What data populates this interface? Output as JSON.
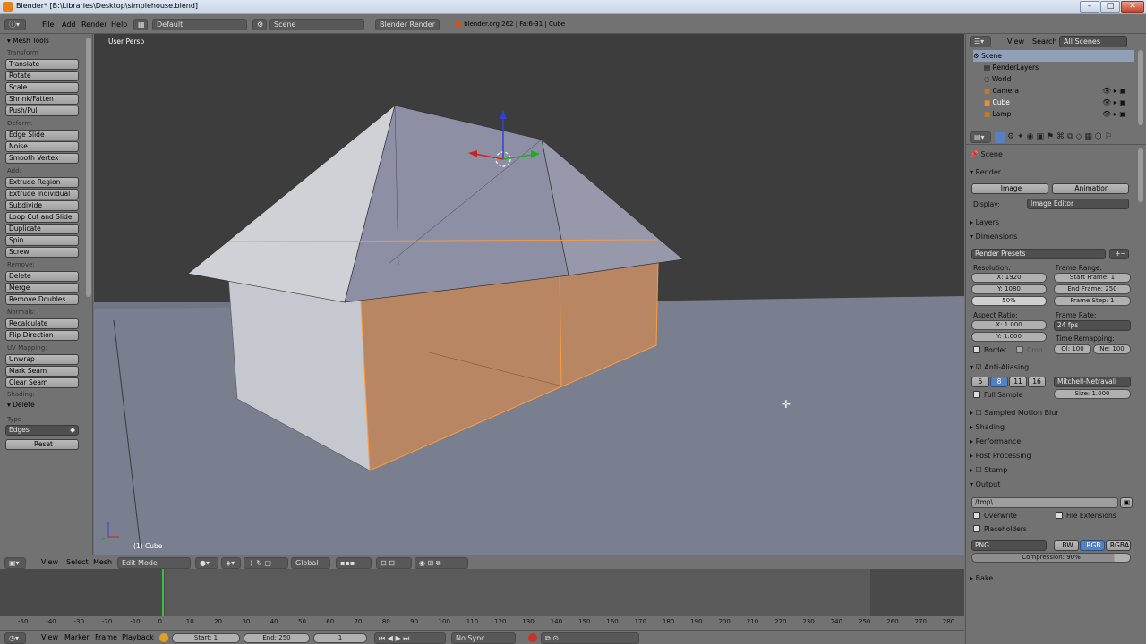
{
  "window": {
    "title": "Blender* [B:\\Libraries\\Desktop\\simplehouse.blend]",
    "min": "–",
    "max": "□",
    "close": "✕"
  },
  "info": {
    "menus": [
      "File",
      "Add",
      "Render",
      "Help"
    ],
    "screen": "Default",
    "scene": "Scene",
    "engine": "Blender Render",
    "stats": "blender.org 262 | Fa:6-31 | Cube"
  },
  "toolshelf": {
    "title": "Mesh Tools",
    "sections": [
      {
        "name": "Transform",
        "items": [
          "Translate",
          "Rotate",
          "Scale",
          "Shrink/Fatten",
          "Push/Pull"
        ]
      },
      {
        "name": "Deform:",
        "items": [
          "Edge Slide",
          "Noise",
          "Smooth Vertex"
        ]
      },
      {
        "name": "Add:",
        "items": [
          "Extrude Region",
          "Extrude Individual",
          "Subdivide",
          "Loop Cut and Slide",
          "Duplicate",
          "Spin",
          "Screw"
        ]
      },
      {
        "name": "Remove:",
        "items": [
          "Delete",
          "Merge",
          "Remove Doubles"
        ]
      },
      {
        "name": "Normals:",
        "items": [
          "Recalculate",
          "Flip Direction"
        ]
      },
      {
        "name": "UV Mapping:",
        "items": [
          "Unwrap",
          "Mark Seam",
          "Clear Seam"
        ]
      }
    ],
    "shading": "Shading:",
    "op_title": "Delete",
    "type_label": "Type",
    "type_value": "Edges",
    "reset": "Reset"
  },
  "viewport": {
    "mode_label": "User Persp",
    "object_label": "(1) Cube"
  },
  "vheader": {
    "menus": [
      "View",
      "Select",
      "Mesh"
    ],
    "mode": "Edit Mode",
    "orientation": "Global"
  },
  "timeline": {
    "ticks": [
      "-50",
      "-40",
      "-30",
      "-20",
      "-10",
      "0",
      "10",
      "20",
      "30",
      "40",
      "50",
      "60",
      "70",
      "80",
      "90",
      "100",
      "110",
      "120",
      "130",
      "140",
      "150",
      "160",
      "170",
      "180",
      "190",
      "200",
      "210",
      "220",
      "230",
      "240",
      "250",
      "260",
      "270",
      "280"
    ],
    "current_frame": 0,
    "menus": [
      "View",
      "Marker",
      "Frame",
      "Playback"
    ],
    "start": "Start: 1",
    "end": "End: 250",
    "frame": "1",
    "sync": "No Sync"
  },
  "outliner": {
    "menus": [
      "View",
      "Search"
    ],
    "scope": "All Scenes",
    "items": [
      "Scene",
      "RenderLayers",
      "World",
      "Camera",
      "Cube",
      "Lamp"
    ]
  },
  "properties": {
    "breadcrumb": "Scene",
    "render_panel": "Render",
    "image_btn": "Image",
    "animation_btn": "Animation",
    "display_label": "Display:",
    "display_value": "Image Editor",
    "layers": "Layers",
    "dimensions": "Dimensions",
    "render_presets": "Render Presets",
    "resolution": "Resolution:",
    "res_x": "X: 1920",
    "res_y": "Y: 1080",
    "res_pct": "50%",
    "frame_range": "Frame Range:",
    "start_frame": "Start Frame: 1",
    "end_frame": "End Frame: 250",
    "frame_step": "Frame Step: 1",
    "aspect": "Aspect Ratio:",
    "asp_x": "X: 1.000",
    "asp_y": "Y: 1.000",
    "frame_rate": "Frame Rate:",
    "fps": "24 fps",
    "time_remap": "Time Remapping:",
    "old": "Ol: 100",
    "new": "Ne: 100",
    "border": "Border",
    "crop": "Crop",
    "aa": "Anti-Aliasing",
    "aa_samples": [
      "5",
      "8",
      "11",
      "16"
    ],
    "aa_filter": "Mitchell-Netravali",
    "full_sample": "Full Sample",
    "size": "Size: 1.000",
    "smb": "Sampled Motion Blur",
    "shading": "Shading",
    "performance": "Performance",
    "post": "Post Processing",
    "stamp": "Stamp",
    "output": "Output",
    "path": "/tmp\\",
    "overwrite": "Overwrite",
    "file_ext": "File Extensions",
    "placeholders": "Placeholders",
    "format": "PNG",
    "bw": "BW",
    "rgb": "RGB",
    "rgba": "RGBA",
    "compression": "Compression: 90%",
    "bake": "Bake"
  }
}
